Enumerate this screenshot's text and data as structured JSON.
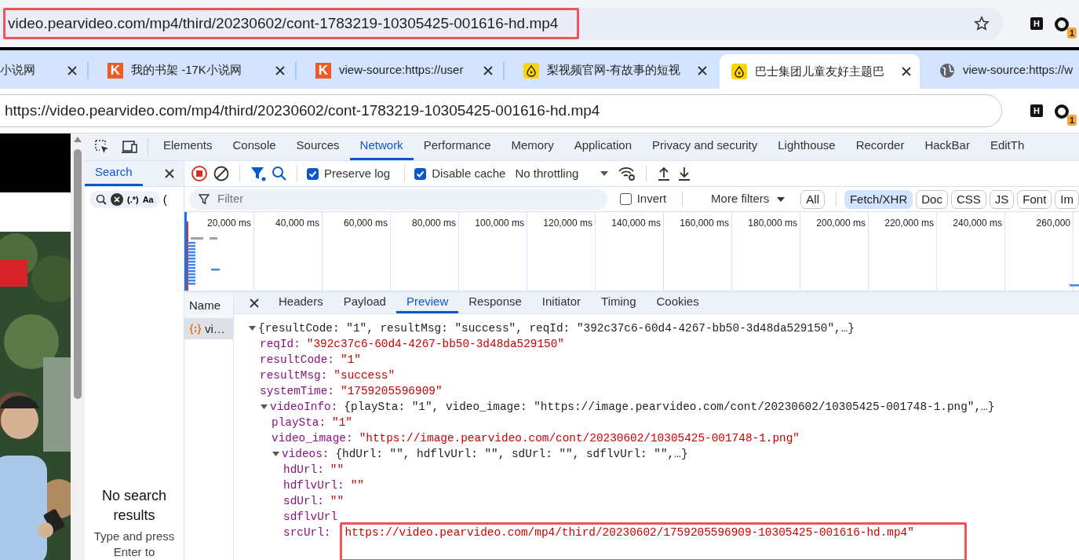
{
  "top_address_bar": {
    "url": "video.pearvideo.com/mp4/third/20230602/cont-1783219-10305425-001616-hd.mp4",
    "highlighted": true,
    "extension_label": "H",
    "extension_badge": "1"
  },
  "browser_tabs": [
    {
      "title": "小说网",
      "kind": "plain",
      "selected": false
    },
    {
      "title": "我的书架 -17K小说网",
      "kind": "letter",
      "logo_text": "K",
      "selected": false
    },
    {
      "title": "view-source:https://user",
      "kind": "letter",
      "logo_text": "K",
      "selected": false
    },
    {
      "title": "梨视频官网-有故事的短视",
      "kind": "pear",
      "selected": false
    },
    {
      "title": "巴士集团儿童友好主题巴",
      "kind": "pear",
      "selected": true
    },
    {
      "title": "view-source:https://w",
      "kind": "web",
      "selected": false
    }
  ],
  "address_bar": {
    "url": "https://video.pearvideo.com/mp4/third/20230602/cont-1783219-10305425-001616-hd.mp4",
    "extension_label": "H",
    "extension_badge": "1"
  },
  "devtools": {
    "tabs": [
      {
        "label": "Elements",
        "selected": false
      },
      {
        "label": "Console",
        "selected": false
      },
      {
        "label": "Sources",
        "selected": false
      },
      {
        "label": "Network",
        "selected": true
      },
      {
        "label": "Performance",
        "selected": false
      },
      {
        "label": "Memory",
        "selected": false
      },
      {
        "label": "Application",
        "selected": false
      },
      {
        "label": "Privacy and security",
        "selected": false
      },
      {
        "label": "Lighthouse",
        "selected": false
      },
      {
        "label": "Recorder",
        "selected": false
      },
      {
        "label": "HackBar",
        "selected": false
      },
      {
        "label": "EditTh",
        "selected": false
      }
    ],
    "search_panel": {
      "tab": "Search",
      "regex_label": "(.*)",
      "case_label": "Aa",
      "cut_label": "(",
      "empty_title": "No search results",
      "empty_hint": "Type and press Enter to"
    },
    "toolbar": {
      "preserve_log": {
        "label": "Preserve log",
        "checked": true
      },
      "disable_cache": {
        "label": "Disable cache",
        "checked": true
      },
      "throttling": "No throttling"
    },
    "filter": {
      "placeholder": "Filter",
      "invert": {
        "label": "Invert",
        "checked": false
      },
      "more_filters": "More filters",
      "chips": [
        {
          "label": "All",
          "selected": false
        },
        {
          "label": "Fetch/XHR",
          "selected": true
        },
        {
          "label": "Doc",
          "selected": false
        },
        {
          "label": "CSS",
          "selected": false
        },
        {
          "label": "JS",
          "selected": false
        },
        {
          "label": "Font",
          "selected": false
        },
        {
          "label": "Im",
          "selected": false
        }
      ]
    },
    "timeline_ticks": [
      "20,000 ms",
      "40,000 ms",
      "60,000 ms",
      "80,000 ms",
      "100,000 ms",
      "120,000 ms",
      "140,000 ms",
      "160,000 ms",
      "180,000 ms",
      "200,000 ms",
      "220,000 ms",
      "240,000 ms",
      "260,000"
    ],
    "name_column": {
      "header": "Name",
      "rows": [
        {
          "name": "vi…",
          "selected": true
        }
      ]
    },
    "detail_tabs": [
      {
        "label": "Headers",
        "selected": false
      },
      {
        "label": "Payload",
        "selected": false
      },
      {
        "label": "Preview",
        "selected": true
      },
      {
        "label": "Response",
        "selected": false
      },
      {
        "label": "Initiator",
        "selected": false
      },
      {
        "label": "Timing",
        "selected": false
      },
      {
        "label": "Cookies",
        "selected": false
      }
    ],
    "preview": [
      {
        "summary": "{resultCode: \"1\", resultMsg: \"success\", reqId: \"392c37c6-60d4-4267-bb50-3d48da529150\",…}",
        "expanded": true,
        "children": [
          {
            "key": "reqId:",
            "value": "\"392c37c6-60d4-4267-bb50-3d48da529150\""
          },
          {
            "key": "resultCode:",
            "value": "\"1\""
          },
          {
            "key": "resultMsg:",
            "value": "\"success\""
          },
          {
            "key": "systemTime:",
            "value": "\"1759205596909\""
          },
          {
            "key": "videoInfo:",
            "summary": "{playSta: \"1\", video_image: \"https://image.pearvideo.com/cont/20230602/10305425-001748-1.png\",…}",
            "expanded": true,
            "children": [
              {
                "key": "playSta:",
                "value": "\"1\""
              },
              {
                "key": "video_image:",
                "value": "\"https://image.pearvideo.com/cont/20230602/10305425-001748-1.png\""
              },
              {
                "key": "videos:",
                "summary": "{hdUrl: \"\", hdflvUrl: \"\", sdUrl: \"\", sdflvUrl: \"\",…}",
                "expanded": true,
                "children": [
                  {
                    "key": "hdUrl:",
                    "value": "\"\""
                  },
                  {
                    "key": "hdflvUrl:",
                    "value": "\"\""
                  },
                  {
                    "key": "sdUrl:",
                    "value": "\"\""
                  },
                  {
                    "key": "sdflvUrl"
                  },
                  {
                    "key": "srcUrl:",
                    "value": "https://video.pearvideo.com/mp4/third/20230602/1759205596909-10305425-001616-hd.mp4\"",
                    "highlighted": true
                  }
                ]
              }
            ]
          }
        ]
      }
    ]
  }
}
